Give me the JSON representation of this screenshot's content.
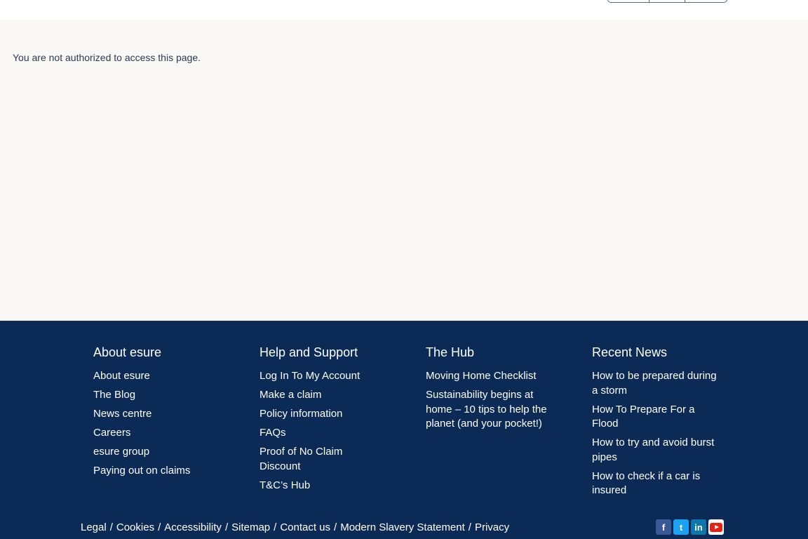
{
  "main": {
    "message": "You are not authorized to access this page."
  },
  "footer": {
    "columns": [
      {
        "title": "About esure",
        "links": [
          "About esure",
          "The Blog",
          "News centre",
          "Careers",
          "esure group",
          "Paying out on claims"
        ]
      },
      {
        "title": "Help and Support",
        "links": [
          "Log In To My Account",
          "Make a claim",
          "Policy information",
          "FAQs",
          "Proof of No Claim Discount",
          "T&C’s Hub"
        ]
      },
      {
        "title": "The Hub",
        "links": [
          "Moving Home Checklist",
          "Sustainability begins at home – 10 tips to help the planet (and your pocket!)"
        ]
      },
      {
        "title": "Recent News",
        "links": [
          "How to be prepared during a storm",
          "How To Prepare For a Flood",
          "How to try and avoid burst pipes",
          "How to check if a car is insured"
        ]
      }
    ],
    "legal_links": [
      "Legal",
      "Cookies",
      "Accessibility",
      "Sitemap",
      "Contact us",
      "Modern Slavery Statement",
      "Privacy"
    ],
    "separator": "/",
    "social": [
      {
        "icon": "facebook-icon",
        "glyph": "f",
        "color": "#3b5998"
      },
      {
        "icon": "twitter-icon",
        "glyph": "t",
        "color": "#1da1f2"
      },
      {
        "icon": "linkedin-icon",
        "glyph": "in",
        "color": "#0e76a8"
      },
      {
        "icon": "youtube-icon",
        "glyph": "",
        "color": "#e62117"
      }
    ]
  },
  "colors": {
    "footer_bg": "#0b2a55",
    "page_bg": "#faf8f4"
  }
}
